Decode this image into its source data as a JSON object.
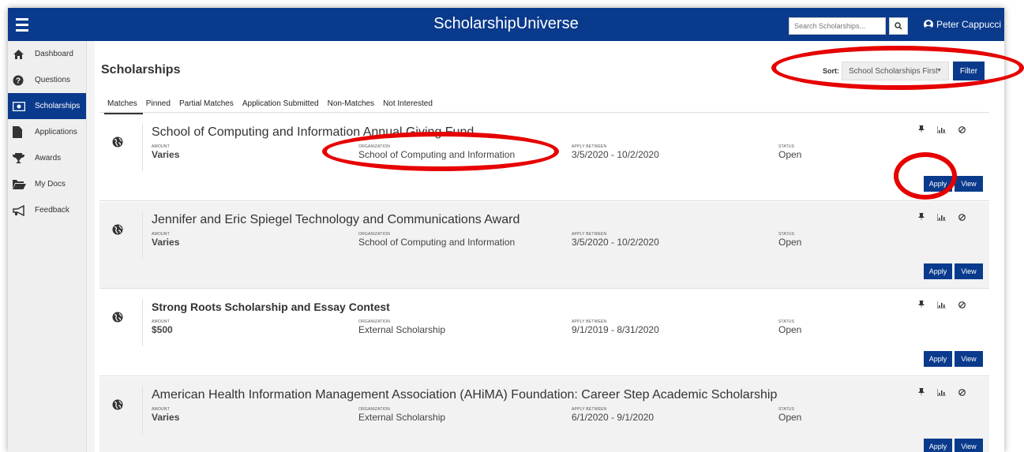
{
  "app": {
    "title": "ScholarshipUniverse"
  },
  "header": {
    "search_placeholder": "Search Scholarships...",
    "user_name": "Peter Cappucci"
  },
  "sidebar": {
    "items": [
      {
        "label": "Dashboard",
        "icon": "home-icon"
      },
      {
        "label": "Questions",
        "icon": "question-icon"
      },
      {
        "label": "Scholarships",
        "icon": "money-icon",
        "active": true
      },
      {
        "label": "Applications",
        "icon": "file-icon"
      },
      {
        "label": "Awards",
        "icon": "trophy-icon"
      },
      {
        "label": "My Docs",
        "icon": "folder-icon"
      },
      {
        "label": "Feedback",
        "icon": "bullhorn-icon"
      }
    ]
  },
  "page": {
    "title": "Scholarships"
  },
  "sort": {
    "label": "Sort:",
    "value": "School Scholarships First",
    "filter_label": "Filter"
  },
  "tabs": [
    "Matches",
    "Pinned",
    "Partial Matches",
    "Application Submitted",
    "Non-Matches",
    "Not Interested"
  ],
  "labels": {
    "amount": "AMOUNT",
    "organization": "ORGANIZATION",
    "apply_between": "APPLY BETWEEN",
    "status": "STATUS",
    "apply": "Apply",
    "view": "View"
  },
  "scholarships": [
    {
      "title": "School of Computing and Information Annual Giving Fund",
      "amount": "Varies",
      "organization": "School of Computing and Information",
      "apply_between": "3/5/2020 - 10/2/2020",
      "status": "Open"
    },
    {
      "title": "Jennifer and Eric Spiegel Technology and Communications Award",
      "amount": "Varies",
      "organization": "School of Computing and Information",
      "apply_between": "3/5/2020 - 10/2/2020",
      "status": "Open"
    },
    {
      "title": "Strong Roots Scholarship and Essay Contest",
      "amount": "$500",
      "organization": "External Scholarship",
      "apply_between": "9/1/2019 - 8/31/2020",
      "status": "Open"
    },
    {
      "title": "American Health Information Management Association (AHiMA) Foundation: Career Step Academic Scholarship",
      "amount": "Varies",
      "organization": "External Scholarship",
      "apply_between": "6/1/2020 - 9/1/2020",
      "status": "Open"
    }
  ],
  "colors": {
    "brand": "#0a3a8c",
    "annotation": "#e60000"
  }
}
